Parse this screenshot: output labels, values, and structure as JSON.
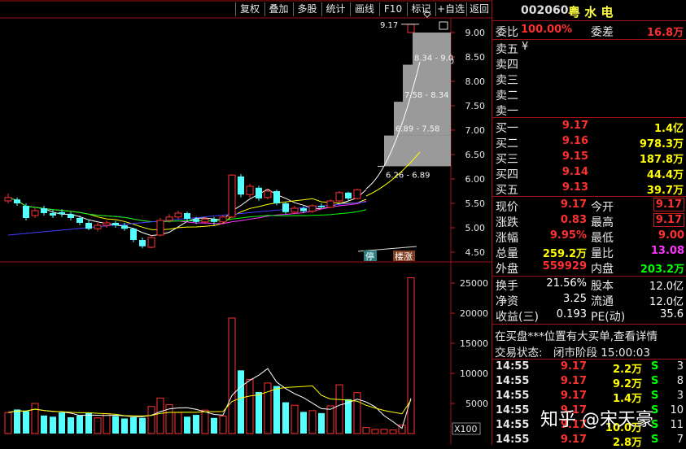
{
  "toolbar": {
    "buttons": [
      "复权",
      "叠加",
      "多股",
      "统计",
      "画线",
      "F10",
      "标记",
      "+自选",
      "返回"
    ]
  },
  "stock": {
    "code": "002060",
    "name": "粤 水 电"
  },
  "price_axis": [
    "9.00",
    "8.50",
    "8.00",
    "7.50",
    "7.00",
    "6.50",
    "6.00",
    "5.50",
    "5.00",
    "4.50"
  ],
  "volume_axis": [
    "25000",
    "20000",
    "15000",
    "10000",
    "5000"
  ],
  "volume_unit": "X100",
  "chart_annotations": {
    "top_price": "9.17",
    "ladder": [
      "8.34 - 9.0",
      "7.58 - 8.34",
      "6.89 - 7.58",
      "6.26 - 6.89"
    ],
    "tag_ting": "停",
    "tag_zhang": "楼涨"
  },
  "order_book": {
    "weibi_label": "委比",
    "weibi_value": "100.00%",
    "weicha_label": "委差",
    "weicha_value": "16.8万",
    "sells": [
      {
        "label": "卖五",
        "price": "¥",
        "vol": ""
      },
      {
        "label": "卖四",
        "price": "",
        "vol": ""
      },
      {
        "label": "卖三",
        "price": "",
        "vol": ""
      },
      {
        "label": "卖二",
        "price": "",
        "vol": ""
      },
      {
        "label": "卖一",
        "price": "",
        "vol": ""
      }
    ],
    "buys": [
      {
        "label": "买一",
        "price": "9.17",
        "vol": "1.4亿"
      },
      {
        "label": "买二",
        "price": "9.16",
        "vol": "978.3万"
      },
      {
        "label": "买三",
        "price": "9.15",
        "vol": "187.8万"
      },
      {
        "label": "买四",
        "price": "9.14",
        "vol": "44.4万"
      },
      {
        "label": "买五",
        "price": "9.13",
        "vol": "39.7万"
      }
    ]
  },
  "quote": {
    "rows": [
      {
        "l1": "现价",
        "v1": "9.17",
        "c1": "red",
        "l2": "今开",
        "v2": "9.17",
        "c2": "red",
        "box": true
      },
      {
        "l1": "涨跌",
        "v1": "0.83",
        "c1": "red",
        "l2": "最高",
        "v2": "9.17",
        "c2": "red",
        "box": true
      },
      {
        "l1": "涨幅",
        "v1": "9.95%",
        "c1": "red",
        "l2": "最低",
        "v2": "9.00",
        "c2": "red",
        "box": false
      },
      {
        "l1": "总量",
        "v1": "259.2万",
        "c1": "yel",
        "l2": "量比",
        "v2": "13.08",
        "c2": "mag",
        "box": false
      },
      {
        "l1": "外盘",
        "v1": "559929",
        "c1": "red",
        "l2": "内盘",
        "v2": "203.2万",
        "c2": "grn",
        "box": false
      }
    ]
  },
  "fundamentals": {
    "rows": [
      {
        "l1": "换手",
        "v1": "21.56%",
        "l2": "股本",
        "v2": "12.0亿"
      },
      {
        "l1": "净资",
        "v1": "3.25",
        "l2": "流通",
        "v2": "12.0亿"
      },
      {
        "l1": "收益(三)",
        "v1": "0.193",
        "l2": "PE(动)",
        "v2": "35.6"
      }
    ]
  },
  "info": {
    "notice": "在买盘***位置有大买单,查看详情",
    "status_label": "交易状态:",
    "status_value": "闭市阶段 15:00:03"
  },
  "ticks": [
    {
      "time": "14:55",
      "price": "9.17",
      "vol": "2.2万",
      "side": "S",
      "num": "3"
    },
    {
      "time": "14:55",
      "price": "9.17",
      "vol": "9.2万",
      "side": "S",
      "num": "8"
    },
    {
      "time": "14:55",
      "price": "9.17",
      "vol": "1.4万",
      "side": "S",
      "num": "3"
    },
    {
      "time": "14:55",
      "price": "9.17",
      "vol": "",
      "side": "S",
      "num": "10"
    },
    {
      "time": "14:55",
      "price": "9.17",
      "vol": "10.0万",
      "side": "S",
      "num": "11"
    },
    {
      "time": "14:55",
      "price": "9.17",
      "vol": "2.8万",
      "side": "S",
      "num": "7"
    }
  ],
  "watermark": "知乎 @宋天豪",
  "chart_data": {
    "type": "candlestick",
    "price_ylim": [
      4.3,
      9.3
    ],
    "volume_ylim": [
      0,
      26500
    ],
    "candles": [
      {
        "o": 5.55,
        "c": 5.62,
        "h": 5.7,
        "l": 5.5,
        "v": 3500
      },
      {
        "o": 5.58,
        "c": 5.5,
        "h": 5.62,
        "l": 5.45,
        "v": 4000
      },
      {
        "o": 5.45,
        "c": 5.2,
        "h": 5.5,
        "l": 5.15,
        "v": 3700
      },
      {
        "o": 5.25,
        "c": 5.35,
        "h": 5.4,
        "l": 5.2,
        "v": 5000
      },
      {
        "o": 5.4,
        "c": 5.3,
        "h": 5.45,
        "l": 5.25,
        "v": 3000
      },
      {
        "o": 5.3,
        "c": 5.25,
        "h": 5.36,
        "l": 5.2,
        "v": 2800
      },
      {
        "o": 5.32,
        "c": 5.28,
        "h": 5.38,
        "l": 5.22,
        "v": 3500
      },
      {
        "o": 5.28,
        "c": 5.2,
        "h": 5.32,
        "l": 5.15,
        "v": 2700
      },
      {
        "o": 5.2,
        "c": 5.1,
        "h": 5.25,
        "l": 5.05,
        "v": 3000
      },
      {
        "o": 5.1,
        "c": 4.98,
        "h": 5.15,
        "l": 4.95,
        "v": 3400
      },
      {
        "o": 4.98,
        "c": 5.05,
        "h": 5.1,
        "l": 4.93,
        "v": 2600
      },
      {
        "o": 5.05,
        "c": 5.1,
        "h": 5.15,
        "l": 5.0,
        "v": 3300
      },
      {
        "o": 5.1,
        "c": 5.05,
        "h": 5.14,
        "l": 5.0,
        "v": 2900
      },
      {
        "o": 5.05,
        "c": 4.98,
        "h": 5.1,
        "l": 4.94,
        "v": 2500
      },
      {
        "o": 4.98,
        "c": 4.75,
        "h": 5.0,
        "l": 4.7,
        "v": 2700
      },
      {
        "o": 4.75,
        "c": 4.62,
        "h": 4.8,
        "l": 4.58,
        "v": 2600
      },
      {
        "o": 4.6,
        "c": 4.8,
        "h": 4.85,
        "l": 4.58,
        "v": 4500
      },
      {
        "o": 4.85,
        "c": 5.15,
        "h": 5.2,
        "l": 4.82,
        "v": 5900
      },
      {
        "o": 5.15,
        "c": 5.22,
        "h": 5.28,
        "l": 5.1,
        "v": 4800
      },
      {
        "o": 5.22,
        "c": 5.3,
        "h": 5.35,
        "l": 5.18,
        "v": 3500
      },
      {
        "o": 5.3,
        "c": 5.18,
        "h": 5.33,
        "l": 5.12,
        "v": 2800
      },
      {
        "o": 5.18,
        "c": 5.12,
        "h": 5.22,
        "l": 5.08,
        "v": 3100
      },
      {
        "o": 5.12,
        "c": 5.18,
        "h": 5.22,
        "l": 5.08,
        "v": 3900
      },
      {
        "o": 5.18,
        "c": 5.12,
        "h": 5.22,
        "l": 5.05,
        "v": 2600
      },
      {
        "o": 5.12,
        "c": 5.22,
        "h": 5.26,
        "l": 5.1,
        "v": 2900
      },
      {
        "o": 5.22,
        "c": 6.08,
        "h": 6.1,
        "l": 5.2,
        "v": 19200
      },
      {
        "o": 6.05,
        "c": 5.68,
        "h": 6.1,
        "l": 5.62,
        "v": 10500
      },
      {
        "o": 5.68,
        "c": 5.85,
        "h": 5.9,
        "l": 5.62,
        "v": 9000
      },
      {
        "o": 5.82,
        "c": 5.6,
        "h": 5.86,
        "l": 5.55,
        "v": 6900
      },
      {
        "o": 5.62,
        "c": 5.75,
        "h": 5.8,
        "l": 5.58,
        "v": 8400
      },
      {
        "o": 5.75,
        "c": 5.5,
        "h": 5.78,
        "l": 5.46,
        "v": 7900
      },
      {
        "o": 5.5,
        "c": 5.32,
        "h": 5.52,
        "l": 5.28,
        "v": 5200
      },
      {
        "o": 5.32,
        "c": 5.4,
        "h": 5.45,
        "l": 5.28,
        "v": 4700
      },
      {
        "o": 5.4,
        "c": 5.34,
        "h": 5.44,
        "l": 5.3,
        "v": 3600
      },
      {
        "o": 5.34,
        "c": 5.45,
        "h": 5.48,
        "l": 5.3,
        "v": 3800
      },
      {
        "o": 5.45,
        "c": 5.42,
        "h": 5.5,
        "l": 5.4,
        "v": 3400
      },
      {
        "o": 5.42,
        "c": 5.55,
        "h": 5.58,
        "l": 5.4,
        "v": 4600
      },
      {
        "o": 5.55,
        "c": 5.72,
        "h": 5.75,
        "l": 5.52,
        "v": 8100
      },
      {
        "o": 5.72,
        "c": 5.6,
        "h": 5.74,
        "l": 5.56,
        "v": 5700
      },
      {
        "o": 5.6,
        "c": 5.78,
        "h": 5.8,
        "l": 5.58,
        "v": 6800
      },
      {
        "o": 5.78,
        "c": 6.26,
        "h": 6.26,
        "l": 5.76,
        "v": 1000
      },
      {
        "o": 6.26,
        "c": 6.89,
        "h": 6.89,
        "l": 6.26,
        "v": 700
      },
      {
        "o": 6.89,
        "c": 7.58,
        "h": 7.58,
        "l": 6.89,
        "v": 700
      },
      {
        "o": 7.58,
        "c": 8.34,
        "h": 8.34,
        "l": 7.58,
        "v": 600
      },
      {
        "o": 8.34,
        "c": 9.17,
        "h": 9.17,
        "l": 8.34,
        "v": 1400
      },
      {
        "o": 9.0,
        "c": 9.17,
        "h": 9.17,
        "l": 9.0,
        "v": 25900
      }
    ]
  }
}
